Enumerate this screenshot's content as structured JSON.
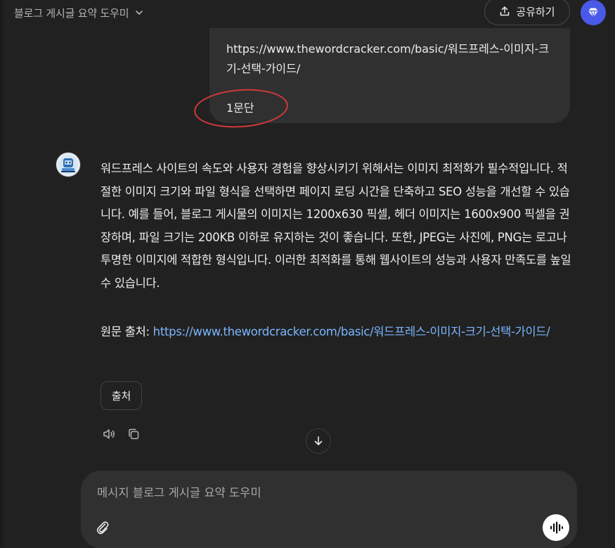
{
  "header": {
    "title": "블로그 게시글 요약 도우미",
    "share_label": "공유하기"
  },
  "user_message": {
    "url": "https://www.thewordcracker.com/basic/워드프레스-이미지-크기-선택-가이드/",
    "paragraph": "1문단"
  },
  "assistant_message": {
    "body": "워드프레스 사이트의 속도와 사용자 경험을 향상시키기 위해서는 이미지 최적화가 필수적입니다. 적절한 이미지 크기와 파일 형식을 선택하면 페이지 로딩 시간을 단축하고 SEO 성능을 개선할 수 있습니다. 예를 들어, 블로그 게시물의 이미지는 1200x630 픽셀, 헤더 이미지는 1600x900 픽셀을 권장하며, 파일 크기는 200KB 이하로 유지하는 것이 좋습니다. 또한, JPEG는 사진에, PNG는 로고나 투명한 이미지에 적합한 형식입니다. 이러한 최적화를 통해 웹사이트의 성능과 사용자 만족도를 높일 수 있습니다.",
    "source_label": "원문 출처: ",
    "source_url": "https://www.thewordcracker.com/basic/워드프레스-이미지-크기-선택-가이드/",
    "source_chip": "출처"
  },
  "composer": {
    "placeholder": "메시지 블로그 게시글 요약 도우미"
  },
  "icons": {
    "header_chevron": "chevron-down-icon",
    "share": "upload-icon",
    "premium": "diamond-icon",
    "read_aloud": "speaker-icon",
    "copy": "copy-icon",
    "scroll": "arrow-down-icon",
    "attach": "paperclip-icon",
    "voice": "voice-waveform-icon"
  },
  "colors": {
    "background": "#212121",
    "bubble": "#303030",
    "link": "#7ab7ff",
    "accent": "#4a5ae8",
    "highlight_circle": "#d43a3a"
  }
}
